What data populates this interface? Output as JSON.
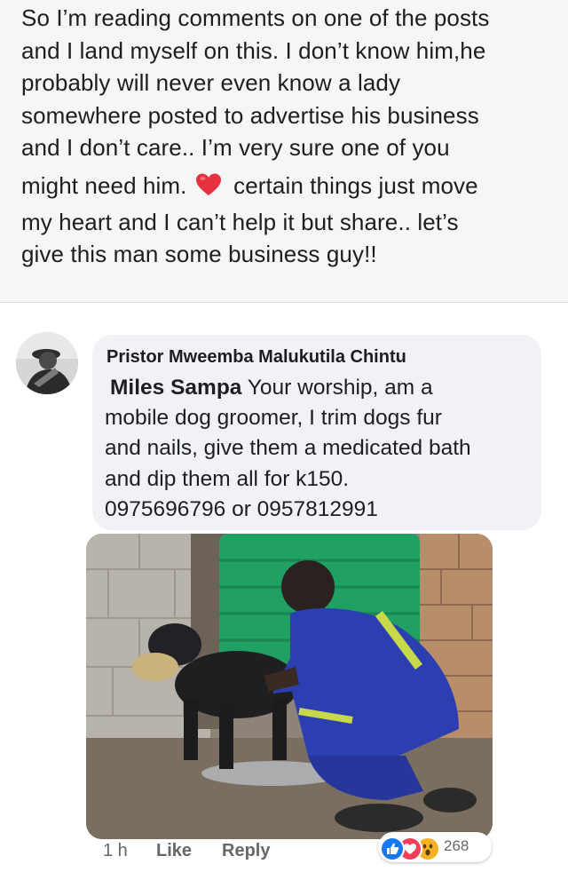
{
  "post": {
    "lines": [
      "So I’m reading comments on one of the posts",
      "and I land myself on this. I don’t know him,he",
      "probably will never even know a lady",
      "somewhere posted to advertise his business",
      "and I don’t care.. I’m very sure one of you",
      "might need him.",
      "certain things just move",
      "my heart and I can’t help it but share.. let’s",
      "give this man some business guy!!"
    ],
    "emoji": "heart-icon"
  },
  "comment": {
    "author": "Pristor Mweemba Malukutila Chintu",
    "mention": "Miles Sampa",
    "line1": "Your worship, am a",
    "lines": [
      "mobile dog groomer, I trim dogs fur",
      "and nails, give them a medicated bath",
      "and dip them all for k150.",
      "0975696796 or 0957812991"
    ],
    "time": "1 h",
    "like_label": "Like",
    "reply_label": "Reply",
    "reaction_count": "268",
    "reactions": [
      "like-icon",
      "love-icon",
      "wow-icon"
    ]
  },
  "colors": {
    "post_bg": "#f6f6f6",
    "bubble_bg": "#f0f2f5",
    "like_blue": "#1877f2",
    "love_red": "#f33e58",
    "wow_yellow": "#f7b125",
    "meta_gray": "#65676b"
  }
}
